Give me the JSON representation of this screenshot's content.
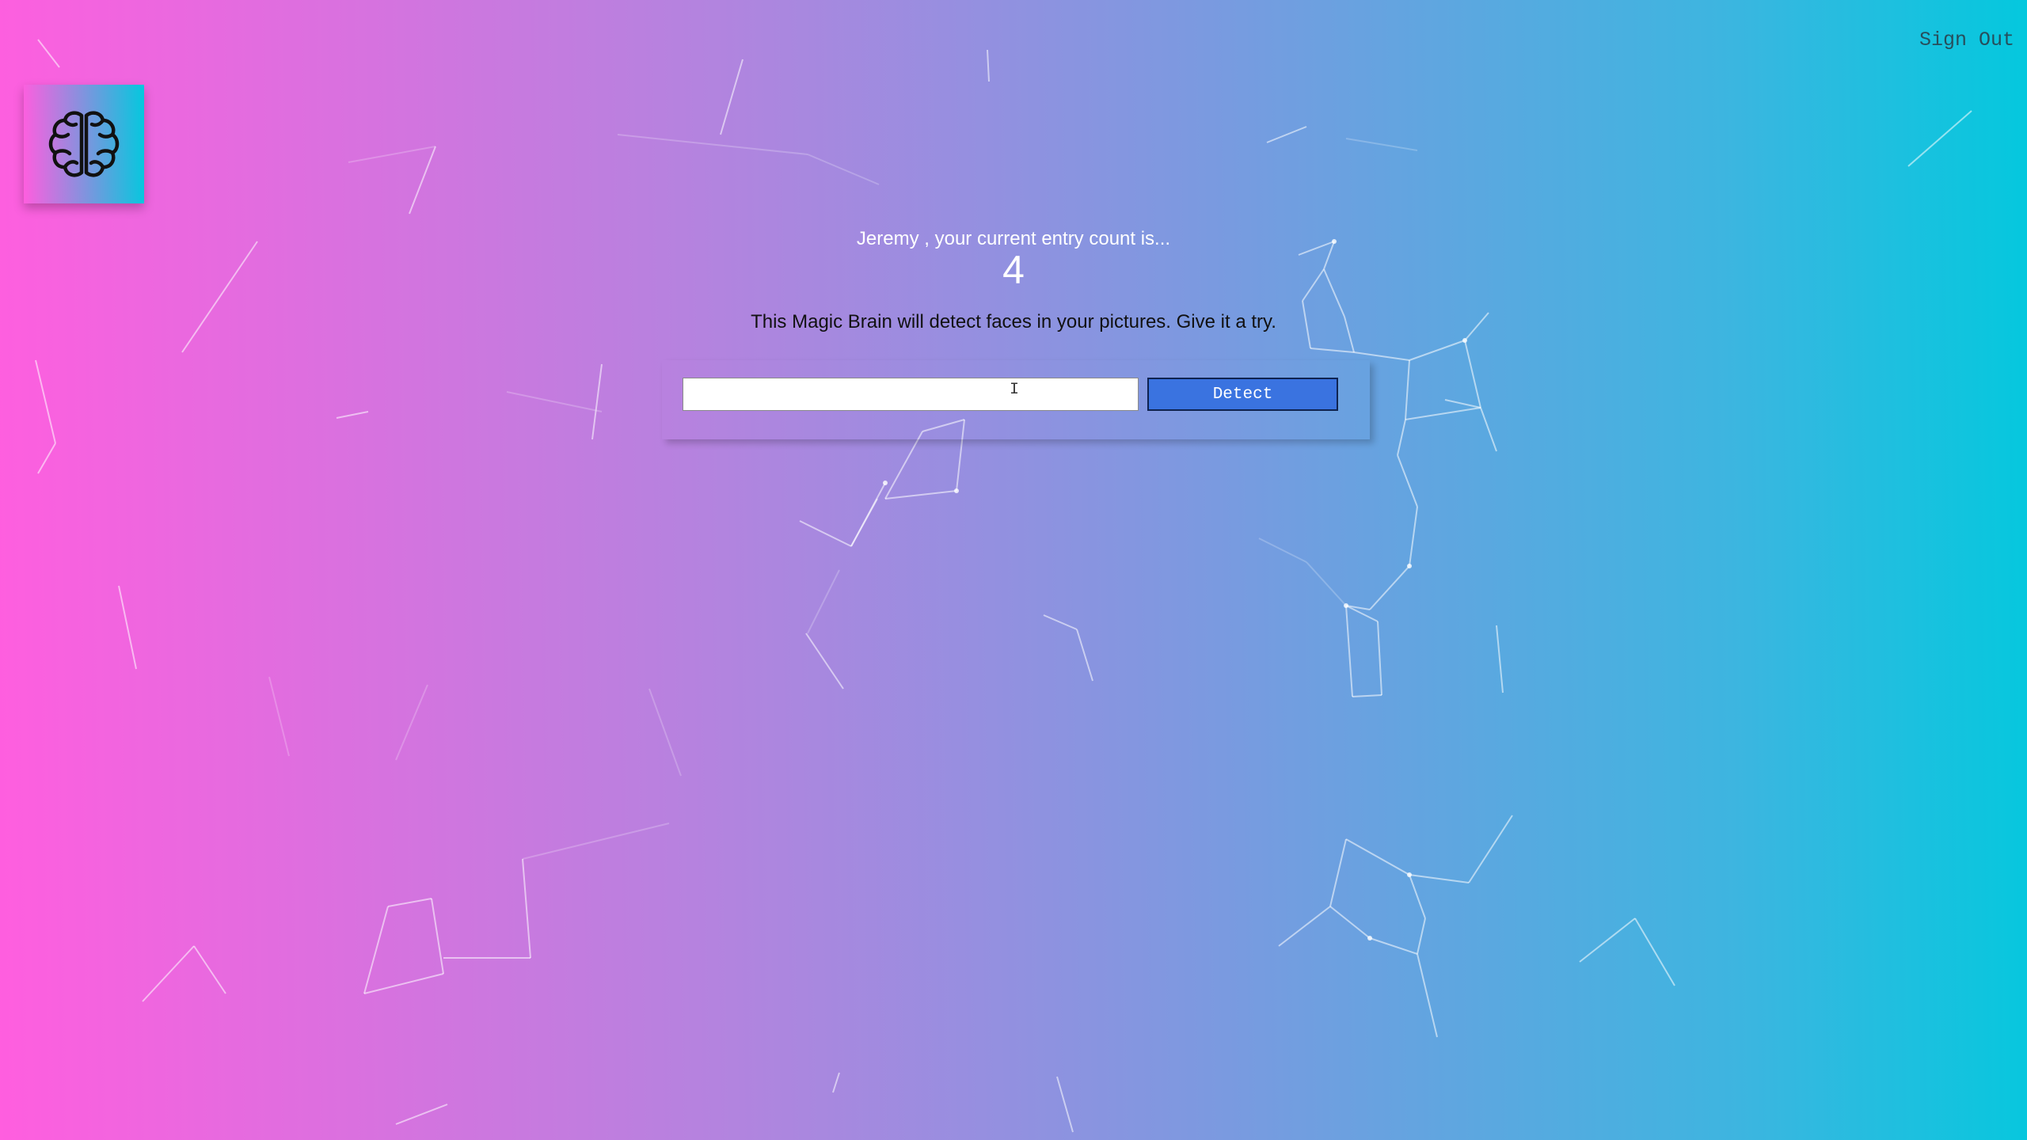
{
  "nav": {
    "sign_out_label": "Sign Out"
  },
  "logo": {
    "icon": "brain-icon"
  },
  "rank": {
    "greeting": "Jeremy , your current entry count is...",
    "count": "4"
  },
  "image_link_form": {
    "description": "This Magic Brain will detect faces in your pictures. Give it a try.",
    "input_value": "",
    "input_placeholder": "",
    "detect_label": "Detect"
  },
  "theme": {
    "gradient_start": "#ff5edf",
    "gradient_end": "#04c8de",
    "button_color": "#3a73e0"
  }
}
